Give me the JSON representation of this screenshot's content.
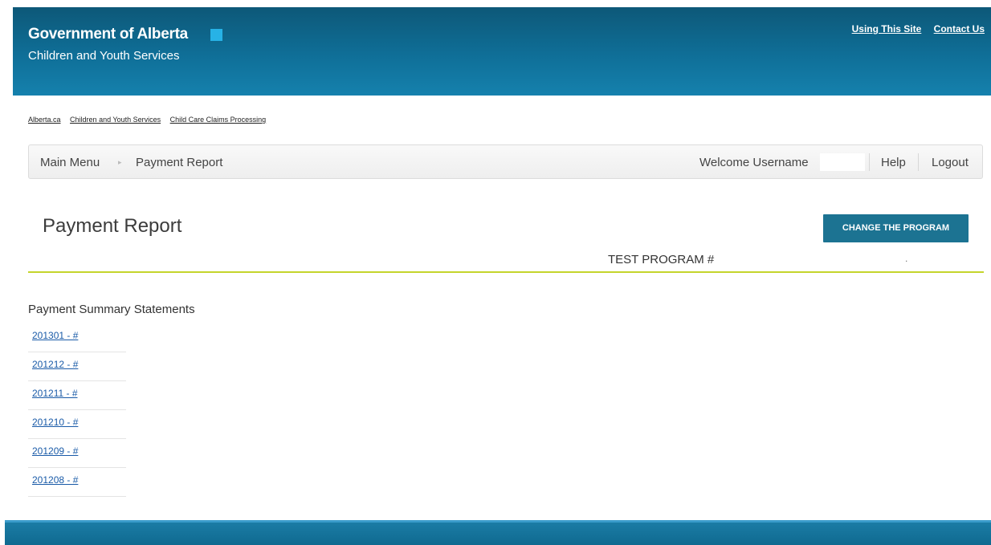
{
  "header": {
    "gov_title": "Government of Alberta",
    "department": "Children and Youth Services",
    "utility_links": [
      "Using This Site",
      "Contact Us"
    ]
  },
  "breadcrumbs": [
    "Alberta.ca",
    "Children and Youth Services",
    "Child Care Claims Processing"
  ],
  "navbar": {
    "main_menu": "Main Menu",
    "separator": "▸",
    "current": "Payment Report",
    "welcome": "Welcome Username",
    "help": "Help",
    "logout": "Logout"
  },
  "page": {
    "title": "Payment Report",
    "change_button": "CHANGE THE PROGRAM",
    "program_label": "TEST PROGRAM #",
    "program_suffix": "."
  },
  "statements": {
    "heading": "Payment Summary Statements",
    "items": [
      "201301 - #",
      "201212 - #",
      "201211 - #",
      "201210 - #",
      "201209 - #",
      "201208 - #"
    ]
  },
  "colors": {
    "header_blue": "#0f6f98",
    "accent_square": "#27b2e6",
    "button_blue": "#1c7392",
    "rule_green": "#c5d52c",
    "link_blue": "#1a5ba8"
  }
}
